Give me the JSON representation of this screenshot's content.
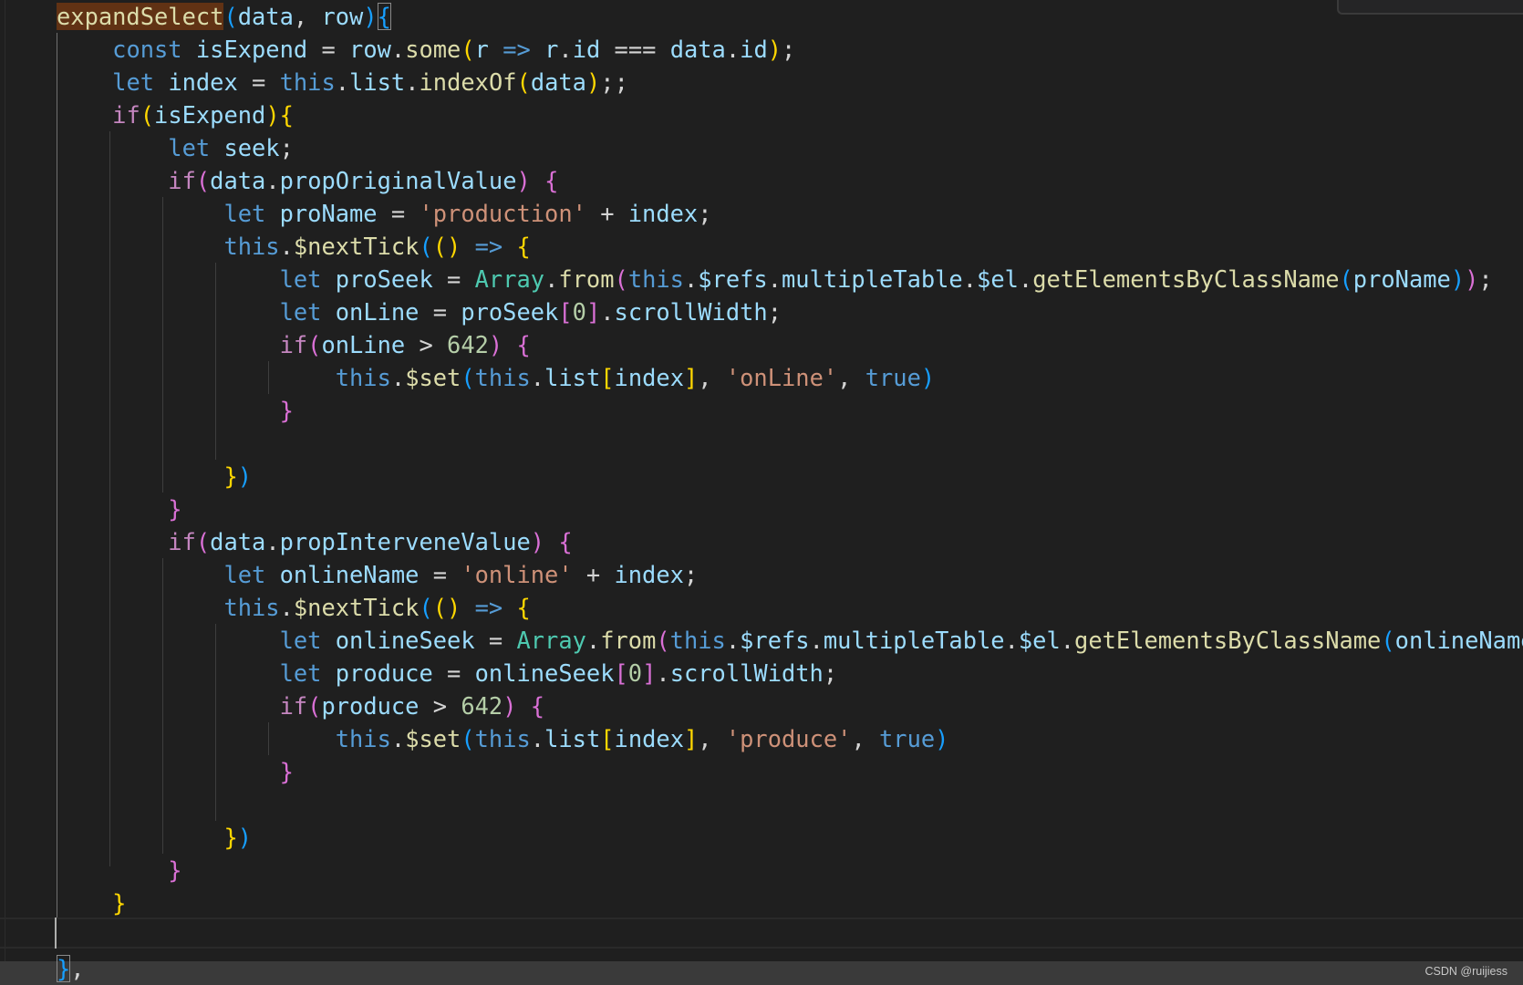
{
  "editor": {
    "theme_colors": {
      "background": "#1f1f1f",
      "keyword": "#569cd6",
      "control": "#c586c0",
      "function": "#dcdcaa",
      "variable": "#9cdcfe",
      "class": "#4ec9b0",
      "string": "#ce9178",
      "number": "#b5cea8",
      "bracket_1": "#ffd700",
      "bracket_2": "#da70d6",
      "bracket_3": "#179fff"
    },
    "lines": [
      {
        "t": [
          [
            "fn",
            "expandSelect"
          ],
          [
            "b3",
            "("
          ],
          [
            "var",
            "data"
          ],
          [
            "p",
            ", "
          ],
          [
            "var",
            "row"
          ],
          [
            "b3",
            ")"
          ],
          [
            "b3",
            "{"
          ]
        ]
      },
      {
        "t": [
          [
            "p",
            "    "
          ],
          [
            "kw",
            "const "
          ],
          [
            "var",
            "isExpend"
          ],
          [
            "p",
            " = "
          ],
          [
            "var",
            "row"
          ],
          [
            "p",
            "."
          ],
          [
            "fn",
            "some"
          ],
          [
            "b1",
            "("
          ],
          [
            "var",
            "r"
          ],
          [
            "kw",
            " => "
          ],
          [
            "var",
            "r"
          ],
          [
            "p",
            "."
          ],
          [
            "var",
            "id"
          ],
          [
            "p",
            " === "
          ],
          [
            "var",
            "data"
          ],
          [
            "p",
            "."
          ],
          [
            "var",
            "id"
          ],
          [
            "b1",
            ")"
          ],
          [
            "p",
            ";"
          ]
        ]
      },
      {
        "t": [
          [
            "p",
            "    "
          ],
          [
            "kw",
            "let "
          ],
          [
            "var",
            "index"
          ],
          [
            "p",
            " = "
          ],
          [
            "kw",
            "this"
          ],
          [
            "p",
            "."
          ],
          [
            "var",
            "list"
          ],
          [
            "p",
            "."
          ],
          [
            "fn",
            "indexOf"
          ],
          [
            "b1",
            "("
          ],
          [
            "var",
            "data"
          ],
          [
            "b1",
            ")"
          ],
          [
            "p",
            ";;"
          ]
        ]
      },
      {
        "t": [
          [
            "p",
            "    "
          ],
          [
            "ctl",
            "if"
          ],
          [
            "b1",
            "("
          ],
          [
            "var",
            "isExpend"
          ],
          [
            "b1",
            ")"
          ],
          [
            "b1",
            "{"
          ]
        ]
      },
      {
        "t": [
          [
            "p",
            "        "
          ],
          [
            "kw",
            "let "
          ],
          [
            "var",
            "seek"
          ],
          [
            "p",
            ";"
          ]
        ]
      },
      {
        "t": [
          [
            "p",
            "        "
          ],
          [
            "ctl",
            "if"
          ],
          [
            "b2",
            "("
          ],
          [
            "var",
            "data"
          ],
          [
            "p",
            "."
          ],
          [
            "var",
            "propOriginalValue"
          ],
          [
            "b2",
            ")"
          ],
          [
            "p",
            " "
          ],
          [
            "b2",
            "{"
          ]
        ]
      },
      {
        "t": [
          [
            "p",
            "            "
          ],
          [
            "kw",
            "let "
          ],
          [
            "var",
            "proName"
          ],
          [
            "p",
            " = "
          ],
          [
            "str",
            "'production'"
          ],
          [
            "p",
            " + "
          ],
          [
            "var",
            "index"
          ],
          [
            "p",
            ";"
          ]
        ]
      },
      {
        "t": [
          [
            "p",
            "            "
          ],
          [
            "kw",
            "this"
          ],
          [
            "p",
            "."
          ],
          [
            "fn",
            "$nextTick"
          ],
          [
            "b3",
            "("
          ],
          [
            "b1",
            "()"
          ],
          [
            "kw",
            " => "
          ],
          [
            "b1",
            "{"
          ]
        ]
      },
      {
        "t": [
          [
            "p",
            "                "
          ],
          [
            "kw",
            "let "
          ],
          [
            "var",
            "proSeek"
          ],
          [
            "p",
            " = "
          ],
          [
            "cls",
            "Array"
          ],
          [
            "p",
            "."
          ],
          [
            "fn",
            "from"
          ],
          [
            "b2",
            "("
          ],
          [
            "kw",
            "this"
          ],
          [
            "p",
            "."
          ],
          [
            "var",
            "$refs"
          ],
          [
            "p",
            "."
          ],
          [
            "var",
            "multipleTable"
          ],
          [
            "p",
            "."
          ],
          [
            "var",
            "$el"
          ],
          [
            "p",
            "."
          ],
          [
            "fn",
            "getElementsByClassName"
          ],
          [
            "b3",
            "("
          ],
          [
            "var",
            "proName"
          ],
          [
            "b3",
            ")"
          ],
          [
            "b2",
            ")"
          ],
          [
            "p",
            ";"
          ]
        ]
      },
      {
        "t": [
          [
            "p",
            "                "
          ],
          [
            "kw",
            "let "
          ],
          [
            "var",
            "onLine"
          ],
          [
            "p",
            " = "
          ],
          [
            "var",
            "proSeek"
          ],
          [
            "b2",
            "["
          ],
          [
            "num",
            "0"
          ],
          [
            "b2",
            "]"
          ],
          [
            "p",
            "."
          ],
          [
            "var",
            "scrollWidth"
          ],
          [
            "p",
            ";"
          ]
        ]
      },
      {
        "t": [
          [
            "p",
            "                "
          ],
          [
            "ctl",
            "if"
          ],
          [
            "b2",
            "("
          ],
          [
            "var",
            "onLine"
          ],
          [
            "p",
            " > "
          ],
          [
            "num",
            "642"
          ],
          [
            "b2",
            ")"
          ],
          [
            "p",
            " "
          ],
          [
            "b2",
            "{"
          ]
        ]
      },
      {
        "t": [
          [
            "p",
            "                    "
          ],
          [
            "kw",
            "this"
          ],
          [
            "p",
            "."
          ],
          [
            "fn",
            "$set"
          ],
          [
            "b3",
            "("
          ],
          [
            "kw",
            "this"
          ],
          [
            "p",
            "."
          ],
          [
            "var",
            "list"
          ],
          [
            "b1",
            "["
          ],
          [
            "var",
            "index"
          ],
          [
            "b1",
            "]"
          ],
          [
            "p",
            ", "
          ],
          [
            "str",
            "'onLine'"
          ],
          [
            "p",
            ", "
          ],
          [
            "kw",
            "true"
          ],
          [
            "b3",
            ")"
          ]
        ]
      },
      {
        "t": [
          [
            "p",
            "                "
          ],
          [
            "b2",
            "}"
          ]
        ]
      },
      {
        "t": []
      },
      {
        "t": [
          [
            "p",
            "            "
          ],
          [
            "b1",
            "}"
          ],
          [
            "b3",
            ")"
          ]
        ]
      },
      {
        "t": [
          [
            "p",
            "        "
          ],
          [
            "b2",
            "}"
          ]
        ]
      },
      {
        "t": [
          [
            "p",
            "        "
          ],
          [
            "ctl",
            "if"
          ],
          [
            "b2",
            "("
          ],
          [
            "var",
            "data"
          ],
          [
            "p",
            "."
          ],
          [
            "var",
            "propInterveneValue"
          ],
          [
            "b2",
            ")"
          ],
          [
            "p",
            " "
          ],
          [
            "b2",
            "{"
          ]
        ]
      },
      {
        "t": [
          [
            "p",
            "            "
          ],
          [
            "kw",
            "let "
          ],
          [
            "var",
            "onlineName"
          ],
          [
            "p",
            " = "
          ],
          [
            "str",
            "'online'"
          ],
          [
            "p",
            " + "
          ],
          [
            "var",
            "index"
          ],
          [
            "p",
            ";"
          ]
        ]
      },
      {
        "t": [
          [
            "p",
            "            "
          ],
          [
            "kw",
            "this"
          ],
          [
            "p",
            "."
          ],
          [
            "fn",
            "$nextTick"
          ],
          [
            "b3",
            "("
          ],
          [
            "b1",
            "()"
          ],
          [
            "kw",
            " => "
          ],
          [
            "b1",
            "{"
          ]
        ]
      },
      {
        "t": [
          [
            "p",
            "                "
          ],
          [
            "kw",
            "let "
          ],
          [
            "var",
            "onlineSeek"
          ],
          [
            "p",
            " = "
          ],
          [
            "cls",
            "Array"
          ],
          [
            "p",
            "."
          ],
          [
            "fn",
            "from"
          ],
          [
            "b2",
            "("
          ],
          [
            "kw",
            "this"
          ],
          [
            "p",
            "."
          ],
          [
            "var",
            "$refs"
          ],
          [
            "p",
            "."
          ],
          [
            "var",
            "multipleTable"
          ],
          [
            "p",
            "."
          ],
          [
            "var",
            "$el"
          ],
          [
            "p",
            "."
          ],
          [
            "fn",
            "getElementsByClassName"
          ],
          [
            "b3",
            "("
          ],
          [
            "var",
            "onlineName"
          ],
          [
            "b3",
            ")"
          ],
          [
            "b2",
            ")"
          ],
          [
            "p",
            ";"
          ]
        ]
      },
      {
        "t": [
          [
            "p",
            "                "
          ],
          [
            "kw",
            "let "
          ],
          [
            "var",
            "produce"
          ],
          [
            "p",
            " = "
          ],
          [
            "var",
            "onlineSeek"
          ],
          [
            "b2",
            "["
          ],
          [
            "num",
            "0"
          ],
          [
            "b2",
            "]"
          ],
          [
            "p",
            "."
          ],
          [
            "var",
            "scrollWidth"
          ],
          [
            "p",
            ";"
          ]
        ]
      },
      {
        "t": [
          [
            "p",
            "                "
          ],
          [
            "ctl",
            "if"
          ],
          [
            "b2",
            "("
          ],
          [
            "var",
            "produce"
          ],
          [
            "p",
            " > "
          ],
          [
            "num",
            "642"
          ],
          [
            "b2",
            ")"
          ],
          [
            "p",
            " "
          ],
          [
            "b2",
            "{"
          ]
        ]
      },
      {
        "t": [
          [
            "p",
            "                    "
          ],
          [
            "kw",
            "this"
          ],
          [
            "p",
            "."
          ],
          [
            "fn",
            "$set"
          ],
          [
            "b3",
            "("
          ],
          [
            "kw",
            "this"
          ],
          [
            "p",
            "."
          ],
          [
            "var",
            "list"
          ],
          [
            "b1",
            "["
          ],
          [
            "var",
            "index"
          ],
          [
            "b1",
            "]"
          ],
          [
            "p",
            ", "
          ],
          [
            "str",
            "'produce'"
          ],
          [
            "p",
            ", "
          ],
          [
            "kw",
            "true"
          ],
          [
            "b3",
            ")"
          ]
        ]
      },
      {
        "t": [
          [
            "p",
            "                "
          ],
          [
            "b2",
            "}"
          ]
        ]
      },
      {
        "t": []
      },
      {
        "t": [
          [
            "p",
            "            "
          ],
          [
            "b1",
            "}"
          ],
          [
            "b3",
            ")"
          ]
        ]
      },
      {
        "t": [
          [
            "p",
            "        "
          ],
          [
            "b2",
            "}"
          ]
        ]
      },
      {
        "t": [
          [
            "p",
            "    "
          ],
          [
            "b1",
            "}"
          ]
        ]
      },
      {
        "t": []
      },
      {
        "t": [
          [
            "b3",
            "}"
          ],
          [
            "p",
            ","
          ]
        ]
      }
    ]
  },
  "watermark": "CSDN @ruijiess"
}
